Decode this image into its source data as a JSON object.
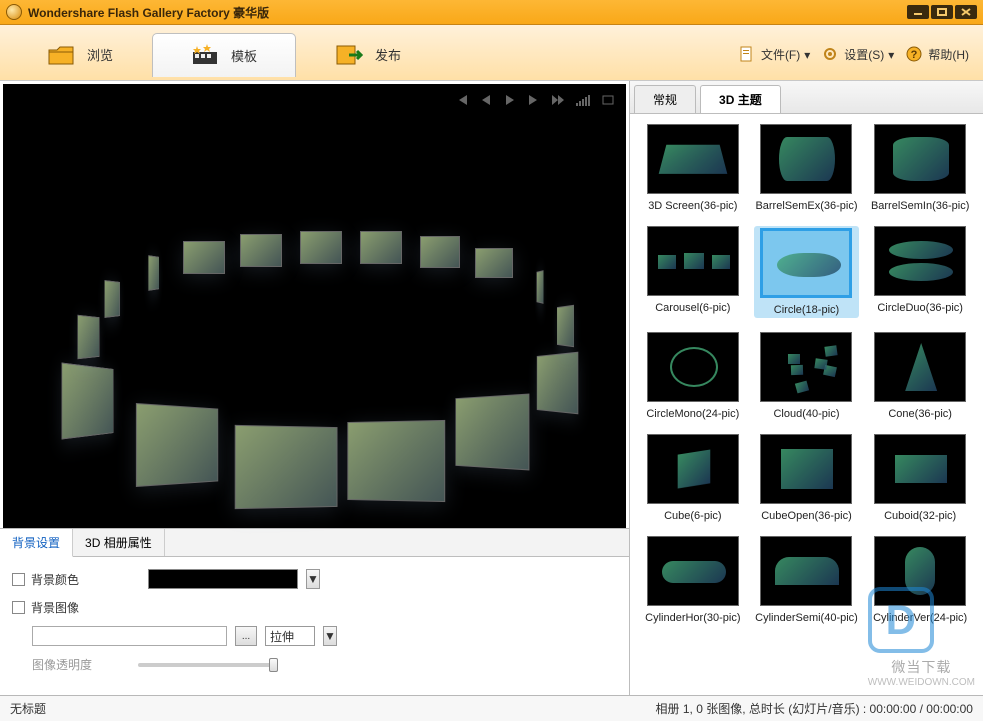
{
  "titlebar": {
    "app_title": "Wondershare Flash Gallery Factory 豪华版"
  },
  "maintabs": {
    "browse": "浏览",
    "template": "模板",
    "publish": "发布"
  },
  "menus": {
    "file": "文件(F)",
    "settings": "设置(S)",
    "help": "帮助(H)"
  },
  "settings_panel": {
    "tabs": {
      "bg": "背景设置",
      "album3d": "3D 相册属性"
    },
    "rows": {
      "bg_color_label": "背景颜色",
      "bg_image_label": "背景图像",
      "stretch_option": "拉伸",
      "opacity_label": "图像透明度"
    }
  },
  "right_panel": {
    "tabs": {
      "normal": "常规",
      "theme3d": "3D 主题"
    },
    "templates": [
      {
        "name": "3D Screen(36-pic)",
        "selected": false
      },
      {
        "name": "BarrelSemEx(36-pic)",
        "selected": false
      },
      {
        "name": "BarrelSemIn(36-pic)",
        "selected": false
      },
      {
        "name": "Carousel(6-pic)",
        "selected": false
      },
      {
        "name": "Circle(18-pic)",
        "selected": true
      },
      {
        "name": "CircleDuo(36-pic)",
        "selected": false
      },
      {
        "name": "CircleMono(24-pic)",
        "selected": false
      },
      {
        "name": "Cloud(40-pic)",
        "selected": false
      },
      {
        "name": "Cone(36-pic)",
        "selected": false
      },
      {
        "name": "Cube(6-pic)",
        "selected": false
      },
      {
        "name": "CubeOpen(36-pic)",
        "selected": false
      },
      {
        "name": "Cuboid(32-pic)",
        "selected": false
      },
      {
        "name": "CylinderHor(30-pic)",
        "selected": false
      },
      {
        "name": "CylinderSemi(40-pic)",
        "selected": false
      },
      {
        "name": "CylinderVer(24-pic)",
        "selected": false
      }
    ]
  },
  "statusbar": {
    "left": "无标题",
    "right": "相册 1, 0 张图像, 总时长 (幻灯片/音乐) : 00:00:00 / 00:00:00"
  },
  "watermark": {
    "text": "微当下载",
    "url": "WWW.WEIDOWN.COM"
  }
}
